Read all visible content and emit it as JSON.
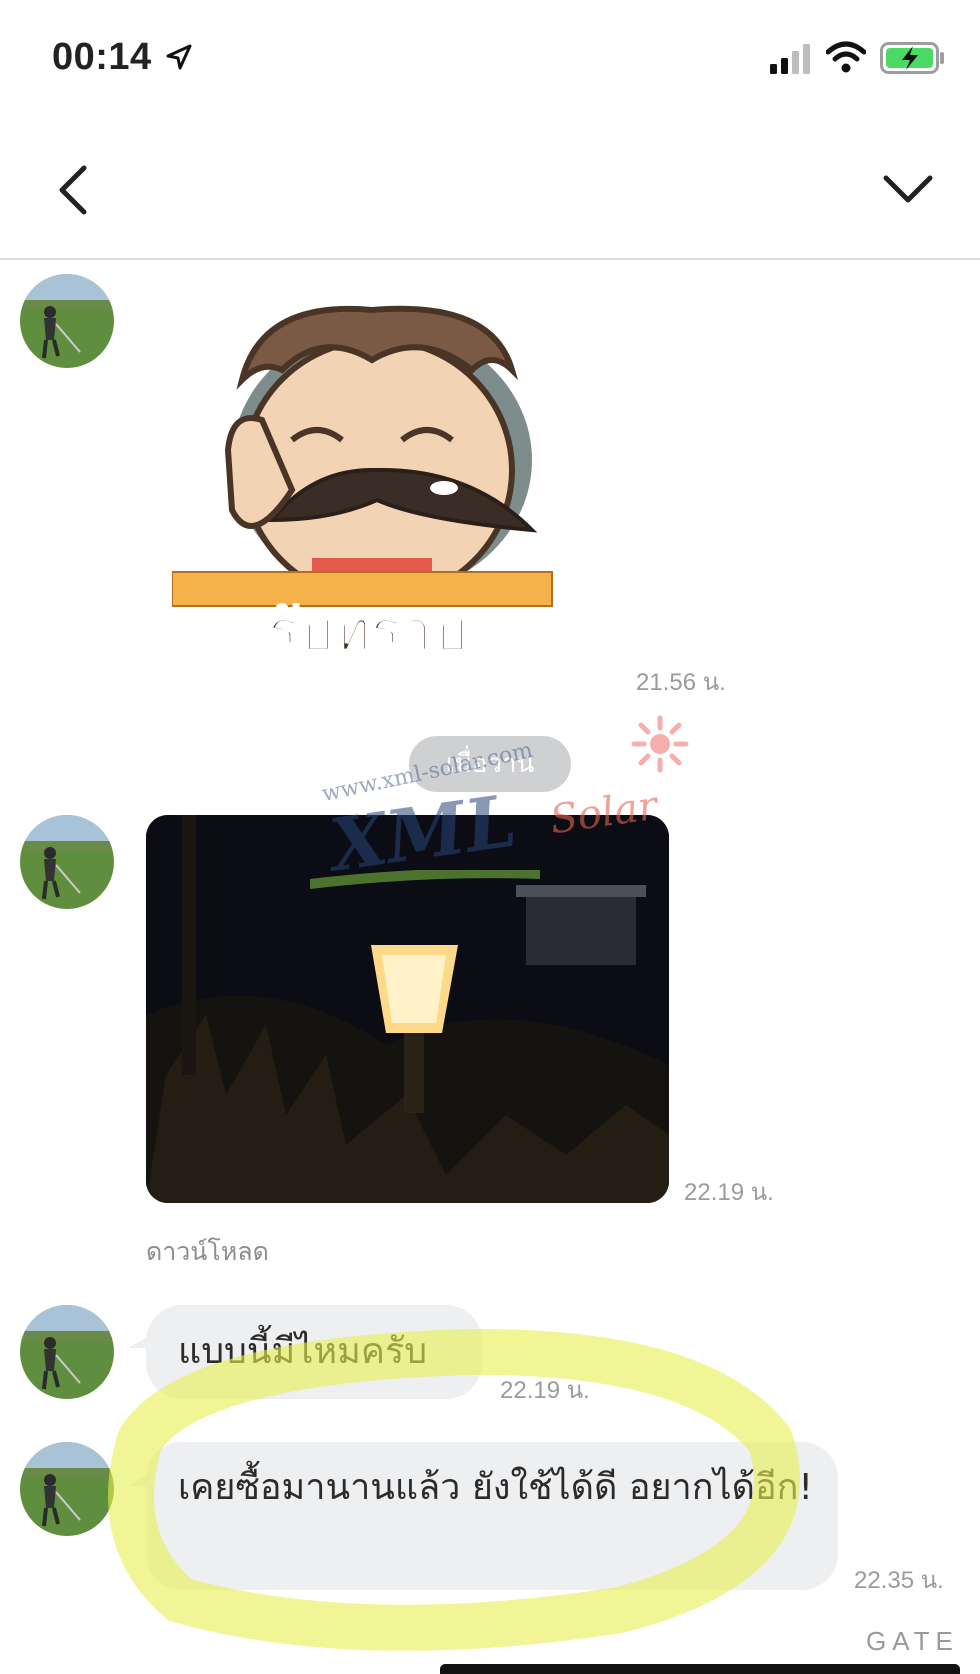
{
  "status_bar": {
    "time": "00:14"
  },
  "sticker": {
    "caption": "รับทราบ"
  },
  "messages": [
    {
      "type": "sticker",
      "time": "21.56 น."
    },
    {
      "type": "date_separator",
      "label": "เมื่อวาน"
    },
    {
      "type": "photo",
      "time": "22.19 น.",
      "download_label": "ดาวน์โหลด",
      "watermark": {
        "brand": "XML",
        "sub": "Solar",
        "url": "www.xml-solar.com"
      }
    },
    {
      "type": "text",
      "text": "แบบนี้มีไหมครับ",
      "time": "22.19 น."
    },
    {
      "type": "text",
      "text": "เคยซื้อมานานแล้ว ยังใช้ได้ดี อยากได้อีก!",
      "time": "22.35 น."
    }
  ],
  "footer": {
    "text": "GATE"
  },
  "colors": {
    "bubble": "#eeeff1",
    "highlight": "#e8ee6a",
    "time_text": "#9b9b9b"
  },
  "icons": [
    "location-arrow-icon",
    "signal-icon",
    "wifi-icon",
    "battery-charging-icon",
    "back-chevron-icon",
    "collapse-chevron-icon"
  ]
}
